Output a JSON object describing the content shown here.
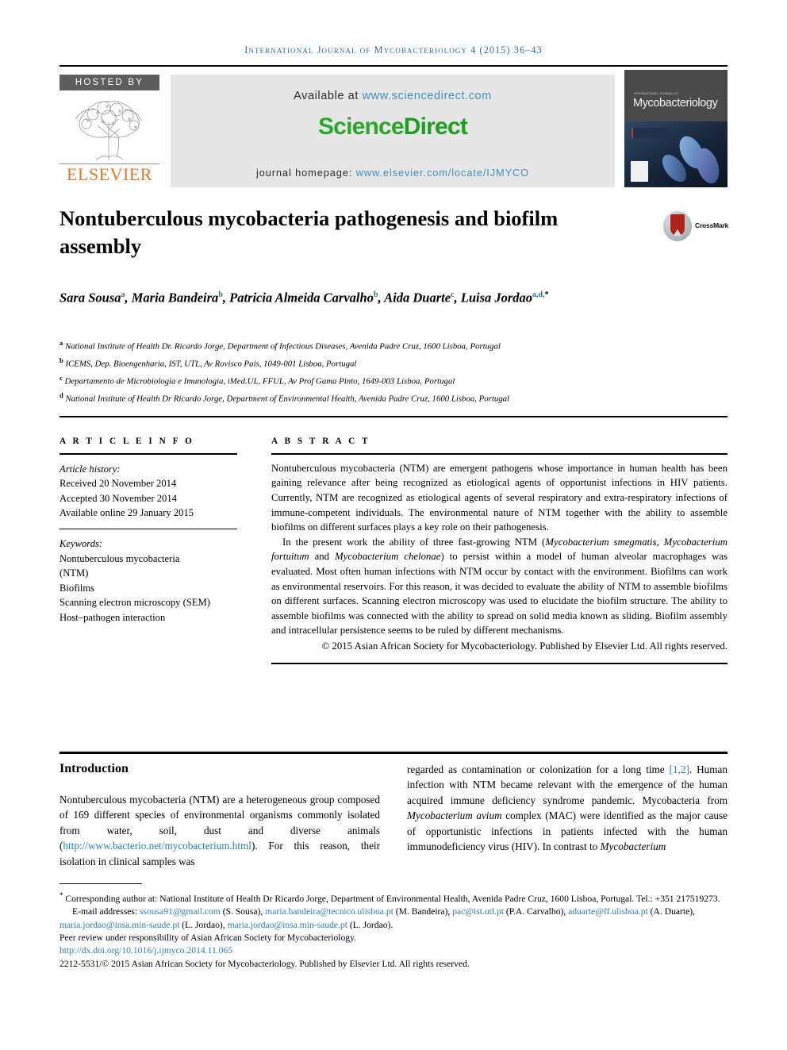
{
  "running_head": "International Journal of Mycobacteriology 4 (2015) 36–43",
  "masthead": {
    "hosted_by": "HOSTED BY",
    "elsevier": "ELSEVIER",
    "available_prefix": "Available at ",
    "available_link": "www.sciencedirect.com",
    "sciencedirect_science": "Science",
    "sciencedirect_direct": "Direct",
    "homepage_prefix": "journal homepage: ",
    "homepage_link": "www.elsevier.com/locate/IJMYCO",
    "cover_kicker": "INTERNATIONAL JOURNAL OF",
    "cover_title": "Mycobacteriology"
  },
  "article": {
    "title": "Nontuberculous mycobacteria pathogenesis and biofilm assembly",
    "crossmark_label": "CrossMark",
    "authors": [
      {
        "name": "Sara Sousa",
        "sup": "a",
        "sep": ", "
      },
      {
        "name": "Maria Bandeira",
        "sup": "b",
        "sep": ", "
      },
      {
        "name": "Patricia Almeida Carvalho",
        "sup": "b",
        "sep": ", "
      },
      {
        "name": "Aida Duarte",
        "sup": "c",
        "sep": ", "
      },
      {
        "name": "Luisa Jordao",
        "sup": "a,d,",
        "sup_star": "*",
        "sep": ""
      }
    ],
    "affiliations": [
      {
        "label": "a",
        "text": "National Institute of Health Dr. Ricardo Jorge, Department of Infectious Diseases, Avenida Padre Cruz, 1600 Lisboa, Portugal"
      },
      {
        "label": "b",
        "text": "ICEMS, Dep. Bioengenharia, IST, UTL, Av Rovisco Pais, 1049-001 Lisboa, Portugal"
      },
      {
        "label": "c",
        "text": "Departamento de Microbiologia e Imunologia, iMed.UL, FFUL, Av Prof Gama Pinto, 1649-003 Lisboa, Portugal"
      },
      {
        "label": "d",
        "text": "National Institute of Health Dr Ricardo Jorge, Department of Environmental Health, Avenida Padre Cruz, 1600 Lisboa, Portugal"
      }
    ]
  },
  "article_info": {
    "heading": "A R T I C L E   I N F O",
    "history_label": "Article history:",
    "history": [
      "Received 20 November 2014",
      "Accepted 30 November 2014",
      "Available online 29 January 2015"
    ],
    "keywords_label": "Keywords:",
    "keywords": [
      "Nontuberculous mycobacteria",
      "(NTM)",
      "Biofilms",
      "Scanning electron microscopy (SEM)",
      "Host–pathogen interaction"
    ]
  },
  "abstract": {
    "heading": "A B S T R A C T",
    "paragraph1": "Nontuberculous mycobacteria (NTM) are emergent pathogens whose importance in human health has been gaining relevance after being recognized as etiological agents of opportunist infections in HIV patients. Currently, NTM are recognized as etiological agents of several respiratory and extra-respiratory infections of immune-competent individuals. The environmental nature of NTM together with the ability to assemble biofilms on different surfaces plays a key role on their pathogenesis.",
    "paragraph2_a": "In the present work the ability of three fast-growing NTM (",
    "species1": "Mycobacterium smegmatis",
    "paragraph2_b": ", ",
    "species2": "Mycobacterium fortuitum",
    "paragraph2_c": " and ",
    "species3": "Mycobacterium chelonae",
    "paragraph2_d": ") to persist within a model of human alveolar macrophages was evaluated. Most often human infections with NTM occur by contact with the environment. Biofilms can work as environmental reservoirs. For this reason, it was decided to evaluate the ability of NTM to assemble biofilms on different surfaces. Scanning electron microscopy was used to elucidate the biofilm structure. The ability to assemble biofilms was connected with the ability to spread on solid media known as sliding. Biofilm assembly and intracellular persistence seems to be ruled by different mechanisms.",
    "copyright": "© 2015 Asian African Society for Mycobacteriology. Published by Elsevier Ltd. All rights reserved."
  },
  "introduction": {
    "heading": "Introduction",
    "left_a": "Nontuberculous mycobacteria (NTM) are a heterogeneous group composed of 169 different species of environmental organisms commonly isolated from water, soil, dust and diverse animals (",
    "left_link": "http://www.bacterio.net/mycobacterium.html",
    "left_b": "). For this reason, their isolation in clinical samples was",
    "right_a": "regarded as contamination or colonization for a long time ",
    "right_ref": "[1,2]",
    "right_b": ". Human infection with NTM became relevant with the emergence of the human acquired immune deficiency syndrome pandemic. Mycobacteria from ",
    "right_species1": "Mycobacterium avium",
    "right_c": " complex (MAC) were identified as the major cause of opportunistic infections in patients infected with the human immunodeficiency virus (HIV). In contrast to ",
    "right_species2": "Mycobacterium"
  },
  "footnotes": {
    "corresponding_star": "*",
    "corresponding": " Corresponding author at: National Institute of Health Dr Ricardo Jorge, Department of Environmental Health, Avenida Padre Cruz, 1600 Lisboa, Portugal. Tel.: +351 217519273.",
    "email_label": "E-mail addresses: ",
    "emails": [
      {
        "address": "ssousa91@gmail.com",
        "owner": " (S. Sousa), "
      },
      {
        "address": "maria.bandeira@tecnico.ulisboa.pt",
        "owner": " (M. Bandeira), "
      },
      {
        "address": "pac@ist.utl.pt",
        "owner": " (P.A. Carvalho), "
      },
      {
        "address": "aduarte@ff.ulisboa.pt",
        "owner": " (A. Duarte), "
      },
      {
        "address": "maria.jordao@insa.min-saude.pt",
        "owner": " (L. Jordao), "
      },
      {
        "address": "maria.jordao@insa.min-saude.pt",
        "owner": " (L. Jordao)."
      }
    ],
    "peer_review": "Peer review under responsibility of Asian African Society for Mycobacteriology.",
    "doi": "http://dx.doi.org/10.1016/j.ijmyco.2014.11.065",
    "issn_line": "2212-5531/© 2015 Asian African Society for Mycobacteriology. Published by Elsevier Ltd. All rights reserved."
  },
  "colors": {
    "link_blue": "#2b7fb0",
    "running_head_blue": "#2b6ea3",
    "sciencedirect_green": "#2aa62a",
    "elsevier_orange": "#e87722",
    "hosted_grey": "#5d5d5d",
    "banner_grey": "#e6e6e6",
    "crossmark_red": "#b02318"
  }
}
